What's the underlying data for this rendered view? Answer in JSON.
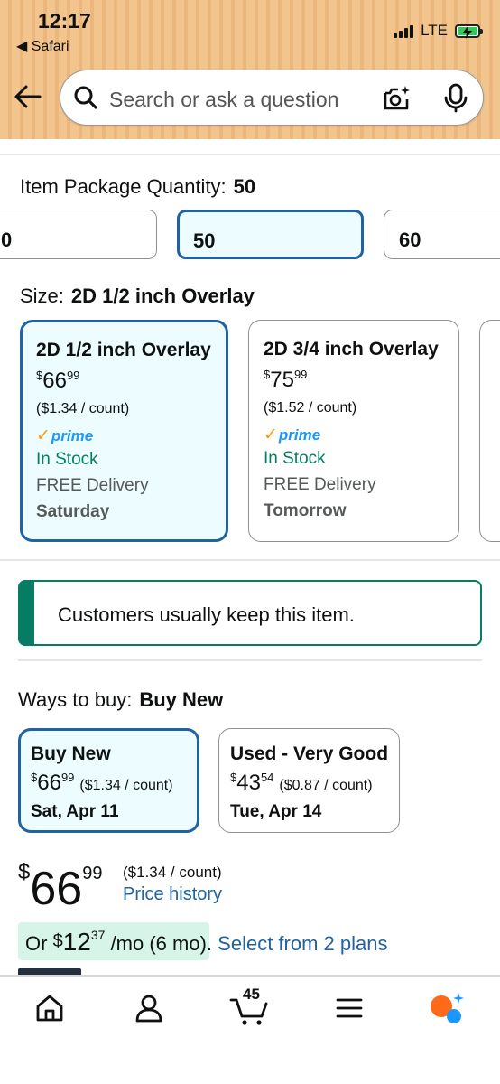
{
  "status_bar": {
    "time": "12:17",
    "back_label": "Safari",
    "network": "LTE"
  },
  "header": {
    "search_placeholder": "Search or ask a question"
  },
  "quantity": {
    "label": "Item Package Quantity:",
    "selected": "50",
    "options": [
      "0",
      "50",
      "60"
    ]
  },
  "size": {
    "label": "Size:",
    "selected": "2D 1/2 inch Overlay",
    "cards": [
      {
        "title": "2D 1/2 inch Overlay",
        "price_symbol": "$",
        "price_whole": "66",
        "price_fraction": "99",
        "unit_price": "($1.34 / count)",
        "prime": "prime",
        "stock": "In Stock",
        "delivery": "FREE Delivery",
        "day": "Saturday"
      },
      {
        "title": "2D 3/4 inch Overlay",
        "price_symbol": "$",
        "price_whole": "75",
        "price_fraction": "99",
        "unit_price": "($1.52 / count)",
        "prime": "prime",
        "stock": "In Stock",
        "delivery": "FREE Delivery",
        "day": "Tomorrow"
      }
    ]
  },
  "keep_banner": {
    "text": "Customers usually keep this item."
  },
  "ways_to_buy": {
    "label": "Ways to buy:",
    "selected": "Buy New",
    "options": [
      {
        "title": "Buy New",
        "price_symbol": "$",
        "price_whole": "66",
        "price_fraction": "99",
        "unit_price": "($1.34 / count)",
        "date": "Sat, Apr 11"
      },
      {
        "title": "Used - Very Good",
        "price_symbol": "$",
        "price_whole": "43",
        "price_fraction": "54",
        "unit_price": "($0.87 / count)",
        "date": "Tue, Apr 14"
      }
    ]
  },
  "price": {
    "symbol": "$",
    "whole": "66",
    "fraction": "99",
    "unit_price": "($1.34 / count)",
    "history_link": "Price history"
  },
  "plan": {
    "prefix": "Or",
    "symbol": "$",
    "whole": "12",
    "fraction": "37",
    "suffix": "/mo (6 mo).",
    "link": "Select from 2 plans"
  },
  "bottom_nav": {
    "cart_count": "45"
  },
  "colors": {
    "accent_blue": "#2162a1",
    "selected_bg": "#edfdff",
    "green": "#067d62",
    "prime_blue": "#1a98ff",
    "prime_check": "#ff9900",
    "header_bg": "#f2c58f"
  }
}
